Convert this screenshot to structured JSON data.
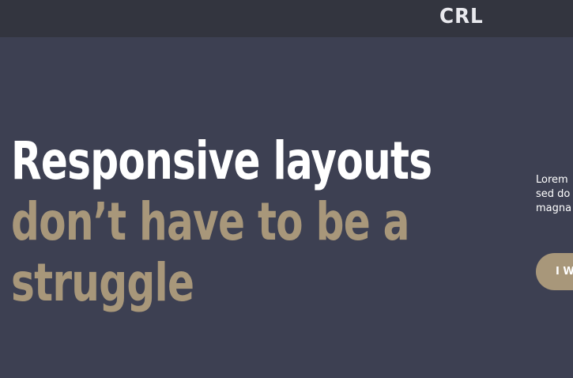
{
  "header": {
    "logo_text": "CRL"
  },
  "hero": {
    "headline_line1": "Responsive layouts",
    "headline_line2": "don’t have to be a",
    "headline_line3": "struggle",
    "paragraph_lines": [
      "Lorem",
      "sed do",
      "magna"
    ],
    "cta_label": "I WA"
  },
  "colors": {
    "header_bg": "#33353f",
    "page_bg": "#3d4052",
    "accent": "#a8977a",
    "text": "#ffffff"
  }
}
